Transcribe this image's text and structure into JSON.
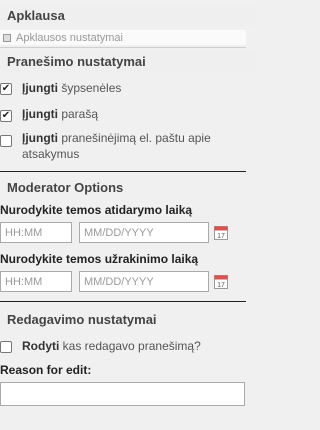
{
  "survey_section": {
    "title": "Apklausa",
    "settings_link": "Apklausos nustatymai"
  },
  "notification_section": {
    "title": "Pranešimo nustatymai",
    "options": [
      {
        "bold": "Įjungti",
        "text": " šypsenėles",
        "checked": true
      },
      {
        "bold": "Įjungti",
        "text": " parašą",
        "checked": true
      },
      {
        "bold": "Įjungti",
        "text": " pranešinėjimą el. paštu apie",
        "text2": "atsakymus",
        "checked": false
      }
    ]
  },
  "moderator_section": {
    "title": "Moderator Options",
    "open_label": "Nurodykite temos atidarymo laiką",
    "close_label": "Nurodykite temos užrakinimo laiką",
    "time_placeholder": "HH:MM",
    "date_placeholder": "MM/DD/YYYY",
    "calendar_day": "17"
  },
  "editing_section": {
    "title": "Redagavimo nustatymai",
    "show_editor_bold": "Rodyti",
    "show_editor_text": " kas redagavo pranešimą?",
    "reason_label": "Reason for edit:",
    "reason_value": ""
  }
}
